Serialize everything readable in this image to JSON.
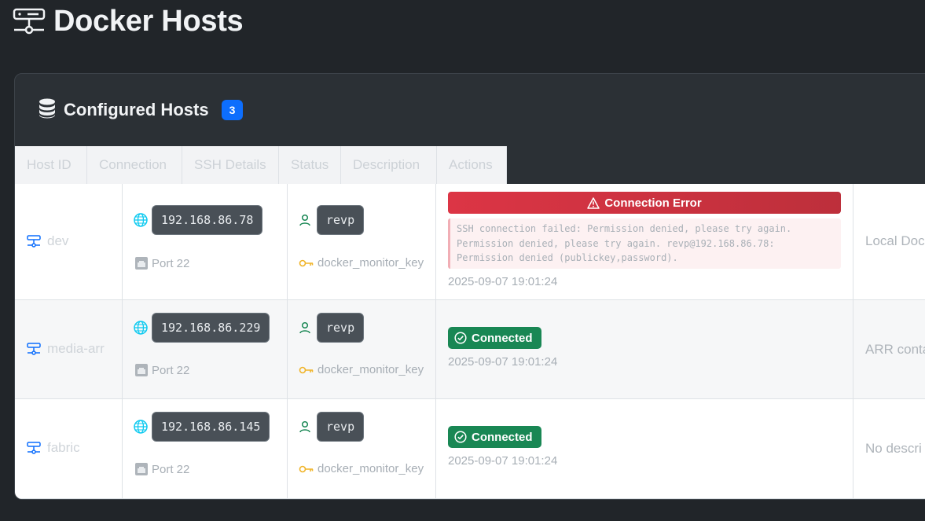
{
  "page": {
    "title": "Docker Hosts",
    "icon": "server-icon"
  },
  "card": {
    "title": "Configured Hosts",
    "count": "3",
    "icon": "database-icon"
  },
  "columns": [
    "Host ID",
    "Connection",
    "SSH Details",
    "Status",
    "Description",
    "Actions"
  ],
  "hosts": [
    {
      "id": "dev",
      "ip": "192.168.86.78",
      "port": "Port 22",
      "user": "revp",
      "key": "docker_monitor_key",
      "status": "Connection Error",
      "error": [
        "SSH connection failed: Permission denied, please try again.",
        "Permission denied, please try again. revp@192.168.86.78:",
        "Permission denied (publickey,password)."
      ],
      "timestamp": "2025-09-07 19:01:24",
      "description": "Local Doc"
    },
    {
      "id": "media-arr",
      "ip": "192.168.86.229",
      "port": "Port 22",
      "user": "revp",
      "key": "docker_monitor_key",
      "status": "Connected",
      "timestamp": "2025-09-07 19:01:24",
      "description": "ARR conta"
    },
    {
      "id": "fabric",
      "ip": "192.168.86.145",
      "port": "Port 22",
      "user": "revp",
      "key": "docker_monitor_key",
      "status": "Connected",
      "timestamp": "2025-09-07 19:01:24",
      "description": "No descri"
    }
  ],
  "colors": {
    "background": "#212529",
    "primary": "#0d6efd",
    "success": "#198754",
    "danger": "#dc3545"
  }
}
